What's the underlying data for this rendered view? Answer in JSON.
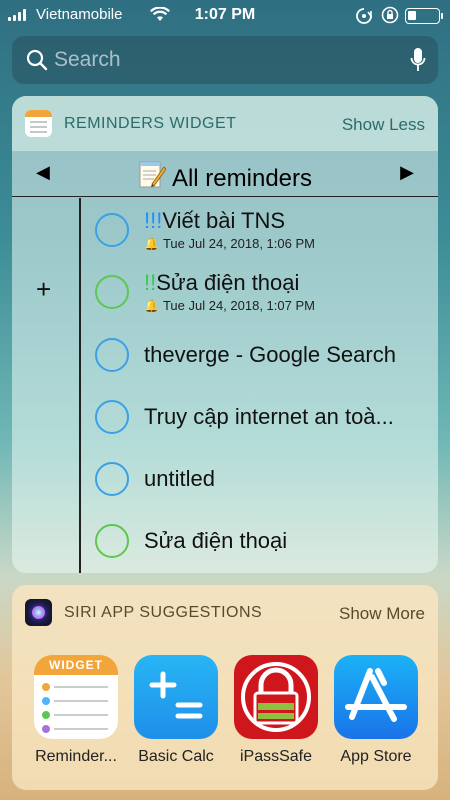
{
  "status_bar": {
    "carrier": "Vietnamobile",
    "time": "1:07 PM"
  },
  "search": {
    "placeholder": "Search"
  },
  "reminders_widget": {
    "title": "REMINDERS WIDGET",
    "toggle_label": "Show Less",
    "list_title": "All reminders",
    "prev_arrow": "◀",
    "next_arrow": "▶",
    "add_label": "+",
    "items": [
      {
        "priority": "!!!",
        "title": "Viết bài TNS",
        "due": "Tue Jul 24, 2018, 1:06 PM",
        "circle_color": "#3ba0e6"
      },
      {
        "priority": "!!",
        "title": "Sửa điện thoại",
        "due": "Tue Jul 24, 2018, 1:07 PM",
        "circle_color": "#5cc84f"
      },
      {
        "priority": "",
        "title": "theverge - Google Search",
        "due": "",
        "circle_color": "#3ba0e6"
      },
      {
        "priority": "",
        "title": "Truy cập internet an toà...",
        "due": "",
        "circle_color": "#3ba0e6"
      },
      {
        "priority": "",
        "title": "untitled",
        "due": "",
        "circle_color": "#3ba0e6"
      },
      {
        "priority": "",
        "title": "Sửa điện thoại",
        "due": "",
        "circle_color": "#5cc84f"
      }
    ]
  },
  "siri_widget": {
    "title": "SIRI APP SUGGESTIONS",
    "toggle_label": "Show More",
    "apps": [
      {
        "label": "Reminder...",
        "icon_text": "WIDGET",
        "icon": "reminders-widget-app-icon"
      },
      {
        "label": "Basic Calc",
        "icon": "calculator-app-icon"
      },
      {
        "label": "iPassSafe",
        "icon": "ipasssafe-lock-app-icon"
      },
      {
        "label": "App Store",
        "icon": "app-store-app-icon"
      }
    ]
  },
  "colors": {
    "priority_blue": "#1e90ff",
    "priority_green": "#3cc94b",
    "widget_accent": "#2c6a6b",
    "reminders_orange": "#f2a53b"
  }
}
